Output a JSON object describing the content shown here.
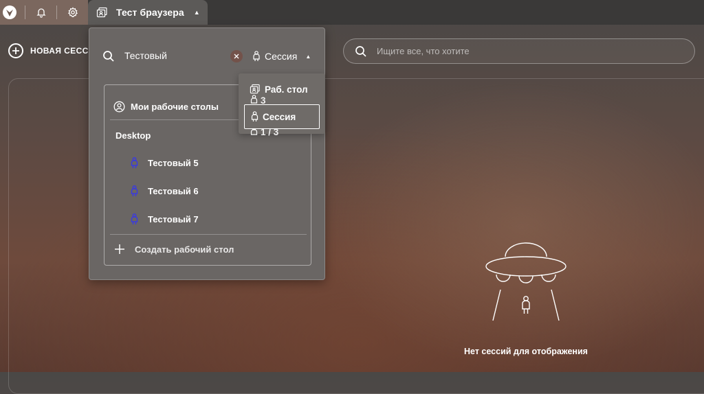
{
  "topbar": {
    "logo_icon": "app-logo-icon",
    "notifications_icon": "bell-icon",
    "settings_icon": "gear-icon",
    "active_tab": {
      "icon": "desktop-sessions-icon",
      "title": "Тест браузера",
      "caret": "▲"
    }
  },
  "toolbar": {
    "new_session_label": "НОВАЯ СЕСС",
    "search_placeholder": "Ищите все, что хотите"
  },
  "dropdown": {
    "search_value": "Тестовый",
    "clear_icon": "close-icon",
    "mode_label": "Сессия",
    "mode_caret": "▲",
    "my_desktops_label": "Мои рабочие столы",
    "group_name": "Desktop",
    "sessions": [
      {
        "label": "Тестовый 5"
      },
      {
        "label": "Тестовый 6"
      },
      {
        "label": "Тестовый 7"
      }
    ],
    "create_desktop_label": "Создать рабочий стол"
  },
  "mode_popup": {
    "options": [
      {
        "label": "Раб. стол",
        "icon": "desktop-sessions-icon"
      },
      {
        "label": "Сессия",
        "icon": "person-icon",
        "selected": true
      }
    ],
    "ghost_values": [
      "3",
      "1 / 3"
    ]
  },
  "empty_state": {
    "text": "Нет сессий для отображения",
    "icon": "ufo-icon"
  },
  "colors": {
    "accent_person": "#3a3adf",
    "topbar": "#3a3938",
    "active_tab": "#5c5a58"
  }
}
